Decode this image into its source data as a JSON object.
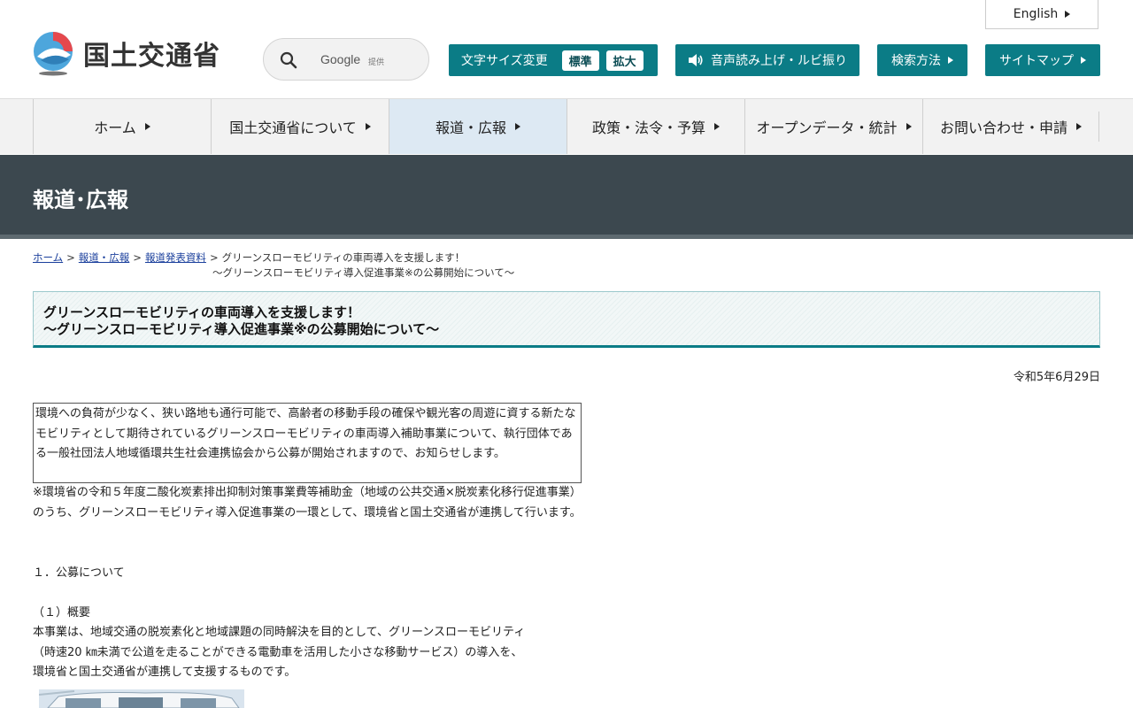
{
  "header": {
    "logo_text": "国土交通省",
    "search": {
      "engine_label": "Google",
      "provided_label": "提供"
    },
    "english_label": "English",
    "font_size": {
      "label": "文字サイズ変更",
      "standard": "標準",
      "large": "拡大"
    },
    "voice_label": "音声読み上げ・ルビ振り",
    "search_method_label": "検索方法",
    "sitemap_label": "サイトマップ"
  },
  "nav": {
    "items": [
      {
        "label": "ホーム",
        "active": false
      },
      {
        "label": "国土交通省について",
        "active": false
      },
      {
        "label": "報道・広報",
        "active": true
      },
      {
        "label": "政策・法令・予算",
        "active": false
      },
      {
        "label": "オープンデータ・統計",
        "active": false
      },
      {
        "label": "お問い合わせ・申請",
        "active": false
      }
    ]
  },
  "category_title": "報道･広報",
  "breadcrumb": {
    "home": "ホーム",
    "press": "報道・広報",
    "releases": "報道発表資料",
    "separator": ">",
    "current_line1": "グリーンスローモビリティの車両導入を支援します！",
    "current_line2": "～グリーンスローモビリティ導入促進事業※の公募開始について～"
  },
  "article": {
    "title_line1": "グリーンスローモビリティの車両導入を支援します！",
    "title_line2": "～グリーンスローモビリティ導入促進事業※の公募開始について～",
    "date": "令和5年6月29日",
    "lead": "環境への負荷が少なく、狭い路地も通行可能で、高齢者の移動手段の確保や観光客の周遊に資する新たなモビリティとして期待されているグリーンスローモビリティの車両導入補助事業について、執行団体である一般社団法人地域循環共生社会連携協会から公募が開始されますので、お知らせします。",
    "note": "※環境省の令和５年度二酸化炭素排出抑制対策事業費等補助金（地域の公共交通×脱炭素化移行促進事業）のうち、グリーンスローモビリティ導入促進事業の一環として、環境省と国土交通省が連携して行います。",
    "section1": "１．公募について",
    "sub1": "（１）概要",
    "desc_line1": "本事業は、地域交通の脱炭素化と地域課題の同時解決を目的として、グリーンスローモビリティ",
    "desc_line2": "（時速20 ㎞未満で公道を走ることができる電動車を活用した小さな移動サービス）の導入を、",
    "desc_line3": "環境省と国土交通省が連携して支援するものです。"
  },
  "colors": {
    "accent": "#0b7c86",
    "category_bar": "#3c484f",
    "nav_bg": "#f2f2f2",
    "nav_active": "#dde9f3",
    "link": "#1a3f9c"
  }
}
